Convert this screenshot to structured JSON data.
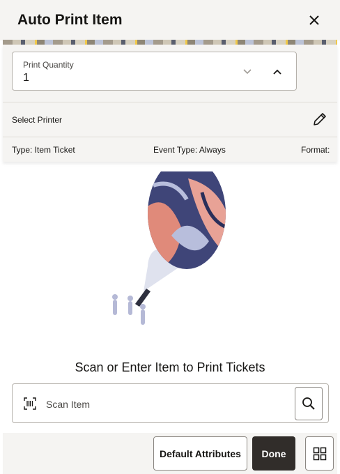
{
  "header": {
    "title": "Auto Print Item",
    "close_icon": "close-icon"
  },
  "print_quantity": {
    "label": "Print Quantity",
    "value": "1"
  },
  "printer": {
    "label": "Select Printer",
    "edit_icon": "pencil-icon"
  },
  "meta": {
    "type": "Type: Item Ticket",
    "event_type": "Event Type: Always",
    "format": "Format:"
  },
  "illustration": {
    "icon": "flashlight-illustration"
  },
  "scan": {
    "prompt": "Scan or Enter Item to Print Tickets",
    "placeholder": "Scan Item",
    "barcode_icon": "barcode-icon",
    "search_icon": "search-icon"
  },
  "footer": {
    "default_attributes_label": "Default Attributes",
    "done_label": "Done",
    "grid_icon": "grid-icon"
  },
  "colors": {
    "header_bg": "#f5f4f2",
    "primary_button": "#312d2a",
    "text": "#161513"
  }
}
